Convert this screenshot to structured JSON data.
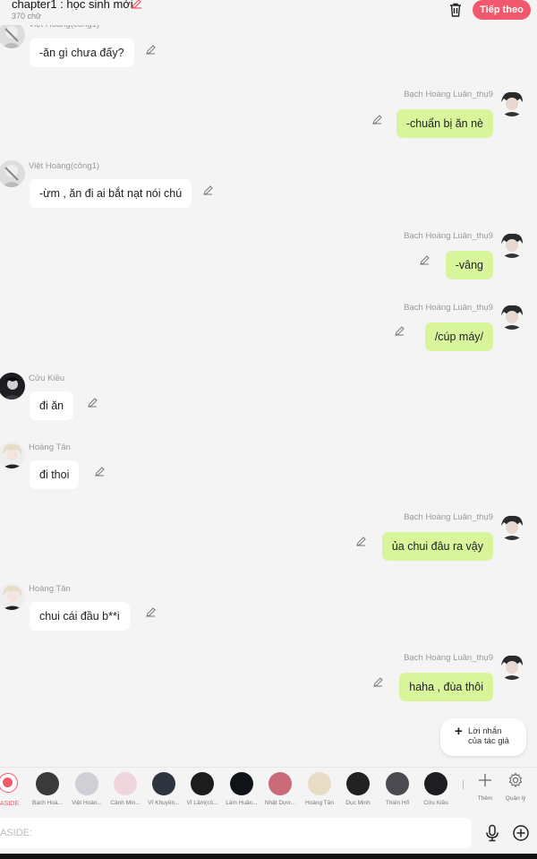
{
  "header": {
    "chapter_title": "chapter1 : học sinh mới",
    "word_count": "370 chữ",
    "next_label": "Tiếp theo"
  },
  "messages": [
    {
      "side": "left",
      "name": "Việt Hoàng(công1)",
      "text": "-ăn gì chưa đấy?"
    },
    {
      "side": "right",
      "name": "Bạch Hoàng Luân_thụ9",
      "text": "-chuẩn bị ăn nè"
    },
    {
      "side": "left",
      "name": "Việt Hoàng(công1)",
      "text": "-ừm , ăn đi ai bắt nạt nói chú"
    },
    {
      "side": "right",
      "name": "Bạch Hoàng Luân_thụ9",
      "text": "-vâng"
    },
    {
      "side": "right",
      "name": "Bạch Hoàng Luân_thụ9",
      "text": "/cúp máy/"
    },
    {
      "side": "left",
      "name": "Cửu Kiều",
      "text": "đi ăn"
    },
    {
      "side": "left",
      "name": "Hoàng Tân",
      "text": "đi thoi"
    },
    {
      "side": "right",
      "name": "Bạch Hoàng Luân_thụ9",
      "text": "ủa chui đâu ra vậy"
    },
    {
      "side": "left",
      "name": "Hoàng Tân",
      "text": "chui cái đầu b**i"
    },
    {
      "side": "right",
      "name": "Bạch Hoàng Luân_thụ9",
      "text": "haha , đùa thôi"
    }
  ],
  "author_note": {
    "plus": "+",
    "line1": "Lời nhắn",
    "line2": "của tác giả"
  },
  "character_bar": {
    "aside_label": "ASIDE",
    "characters": [
      "Bạch Hoà...",
      "Việt Hoàn...",
      "Cảnh Min...",
      "Vĩ Khuyên...",
      "Vĩ Lâm(cô...",
      "Lâm Huân...",
      "Nhật Dươ...",
      "Hoàng Tân",
      "Dục Minh",
      "Thiên Hổ",
      "Cửu Kiều"
    ],
    "more_label": "Thêm",
    "manage_label": "Quản lý"
  },
  "input": {
    "placeholder": "ASIDE:"
  },
  "colors": {
    "accent": "#f2586d",
    "bubble_right": "#d9f59c",
    "bubble_left": "#ffffff",
    "background": "#f4f4f4"
  },
  "icons": [
    "pencil-icon",
    "trash-icon",
    "mic-icon",
    "plus-circle-icon",
    "gear-icon",
    "plus-icon",
    "chat-bubble-icon"
  ]
}
